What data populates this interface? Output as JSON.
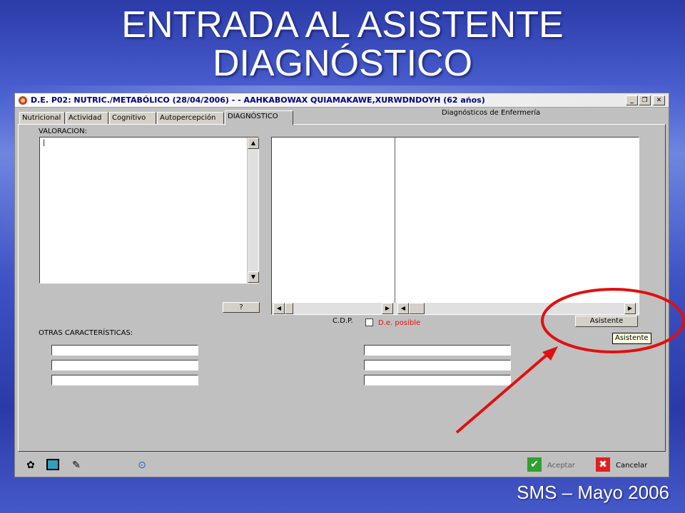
{
  "slide": {
    "title_line1": "ENTRADA AL ASISTENTE",
    "title_line2": "DIAGNÓSTICO",
    "footer": "SMS – Mayo 2006"
  },
  "window": {
    "title": "D.E. P02: NUTRIC./METABÓLICO (28/04/2006) - - AAHKABOWAX QUIAMAKAWE,XURWDNDOYH (62 años)",
    "minimize": "_",
    "restore": "❐",
    "close": "✕"
  },
  "tabs": [
    {
      "label": "Nutricional"
    },
    {
      "label": "Actividad"
    },
    {
      "label": "Cognitivo"
    },
    {
      "label": "Autopercepción"
    },
    {
      "label": "DIAGNÓSTICO"
    }
  ],
  "panel": {
    "valoracion_label": "VALORACION:",
    "valoracion_value": "|",
    "help_button": "?",
    "diagnosticos_label": "Diagnósticos de Enfermería",
    "cdp_label": "C.D.P.",
    "posible_label": "D.e. posible",
    "asistente_button": "Asistente",
    "asistente_tooltip": "Asistente",
    "otras_label": "OTRAS CARACTERÍSTICAS:"
  },
  "toolbar": {
    "aceptar_label": "Aceptar",
    "cancelar_label": "Cancelar"
  },
  "colors": {
    "highlight_circle": "#e01010",
    "arrow": "#e01010",
    "posible_text": "#e01010"
  }
}
